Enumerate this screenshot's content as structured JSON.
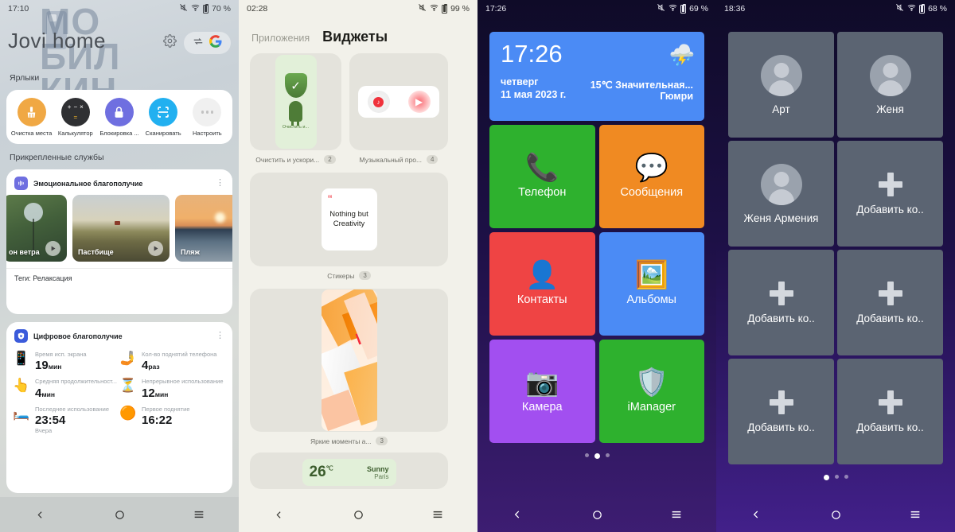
{
  "panel1": {
    "statusbar": {
      "time": "17:10",
      "battery": "70 %",
      "icons": [
        "mute-icon",
        "wifi-icon",
        "battery-icon"
      ]
    },
    "watermark": [
      "МО",
      "БИЛ",
      "КИН"
    ],
    "brand": "Jovi home",
    "icons": {
      "settings": "gear-icon",
      "swap": "swap-icon",
      "google": "google-icon"
    },
    "shortcuts_label": "Ярлыки",
    "shortcuts": [
      {
        "label": "Очистка места",
        "icon": "broom-icon",
        "color": "#f0a844"
      },
      {
        "label": "Калькулятор",
        "icon": "calculator-icon",
        "color": "#2f3033"
      },
      {
        "label": "Блокировка ...",
        "icon": "lock-icon",
        "color": "#6f6fe0"
      },
      {
        "label": "Сканировать",
        "icon": "scan-icon",
        "color": "#22b0f0"
      },
      {
        "label": "Настроить",
        "icon": "more-dots-icon",
        "color": "#f0f0f0"
      }
    ],
    "pinned_label": "Прикрепленные службы",
    "emotional": {
      "title": "Эмоциональное благополучие",
      "badge": "waveform-icon",
      "menu": "more-vertical-icon",
      "items": [
        {
          "label": "он ветра",
          "play": true
        },
        {
          "label": "Пастбище",
          "play": true
        },
        {
          "label": "Пляж",
          "play": false
        }
      ],
      "tags": "Теги: Релаксация"
    },
    "digital": {
      "title": "Цифровое благополучие",
      "badge": "shield-heart-icon",
      "menu": "more-vertical-icon",
      "stats": [
        {
          "icon": "phone-clock-icon",
          "key": "Время исп. экрана",
          "value": "19",
          "unit": "мин",
          "sub": ""
        },
        {
          "icon": "hand-phone-icon",
          "key": "Кол-во поднятий телефона",
          "value": "4",
          "unit": "раз",
          "sub": ""
        },
        {
          "icon": "tap-phone-icon",
          "key": "Средняя продолжительност...",
          "value": "4",
          "unit": "мин",
          "sub": ""
        },
        {
          "icon": "hourglass-icon",
          "key": "Непрерывное использование",
          "value": "12",
          "unit": "мин",
          "sub": ""
        },
        {
          "icon": "moon-bed-icon",
          "key": "Последнее использование",
          "value": "23:54",
          "unit": "",
          "sub": "Вчера"
        },
        {
          "icon": "sunrise-icon",
          "key": "Первое поднятие",
          "value": "16:22",
          "unit": "",
          "sub": ""
        }
      ]
    },
    "nav": [
      "back-icon",
      "home-icon",
      "recents-icon"
    ]
  },
  "panel2": {
    "statusbar": {
      "time": "02:28",
      "battery": "99 %"
    },
    "tabs": [
      {
        "label": "Приложения",
        "active": false
      },
      {
        "label": "Виджеты",
        "active": true
      }
    ],
    "widgets": [
      {
        "caption": "Очистить и ускори...",
        "count": "2",
        "icon": "clean-boost-widget",
        "card_text": "Очистить и..."
      },
      {
        "caption": "Музыкальный про...",
        "count": "4",
        "icon": "music-player-widget"
      },
      {
        "caption": "Стикеры",
        "count": "3",
        "icon": "sticker-widget",
        "card_text": "Nothing but Creativity"
      },
      {
        "caption": "Яркие моменты а...",
        "count": "3",
        "icon": "bright-moments-widget"
      }
    ],
    "weather_preview": {
      "temp": "26",
      "unit": "℃",
      "cond": "Sunny",
      "city": "Paris"
    },
    "nav": [
      "back-icon",
      "home-icon",
      "recents-icon"
    ]
  },
  "panel3": {
    "statusbar": {
      "time": "17:26",
      "battery": "69 %"
    },
    "clock_widget": {
      "time": "17:26",
      "weekday": "четверг",
      "date": "11 мая 2023 г.",
      "temp_cond": "15℃ Значительная...",
      "city": "Гюмри",
      "icon": "thunderstorm-icon",
      "color": "#4b8bf5"
    },
    "apps": [
      {
        "label": "Телефон",
        "icon": "phone-icon",
        "color": "#2eb12e"
      },
      {
        "label": "Сообщения",
        "icon": "message-icon",
        "color": "#f08a22"
      },
      {
        "label": "Контакты",
        "icon": "contacts-icon",
        "color": "#ef4444"
      },
      {
        "label": "Альбомы",
        "icon": "albums-icon",
        "color": "#4b8bf5"
      },
      {
        "label": "Камера",
        "icon": "camera-icon",
        "color": "#a24ff0"
      },
      {
        "label": "iManager",
        "icon": "imanager-icon",
        "color": "#2eb12e"
      }
    ],
    "page_dots": {
      "count": 3,
      "active": 1
    },
    "nav": [
      "back-icon",
      "home-icon",
      "recents-icon"
    ]
  },
  "panel4": {
    "statusbar": {
      "time": "18:36",
      "battery": "68 %"
    },
    "contacts": [
      {
        "label": "Арт",
        "type": "contact"
      },
      {
        "label": "Женя",
        "type": "contact"
      },
      {
        "label": "Женя Армения",
        "type": "contact"
      },
      {
        "label": "Добавить ко..",
        "type": "add"
      },
      {
        "label": "Добавить ко..",
        "type": "add"
      },
      {
        "label": "Добавить ко..",
        "type": "add"
      },
      {
        "label": "Добавить ко..",
        "type": "add"
      },
      {
        "label": "Добавить ко..",
        "type": "add"
      }
    ],
    "page_dots": {
      "count": 3,
      "active": 0
    },
    "nav": [
      "back-icon",
      "home-icon",
      "recents-icon"
    ]
  }
}
